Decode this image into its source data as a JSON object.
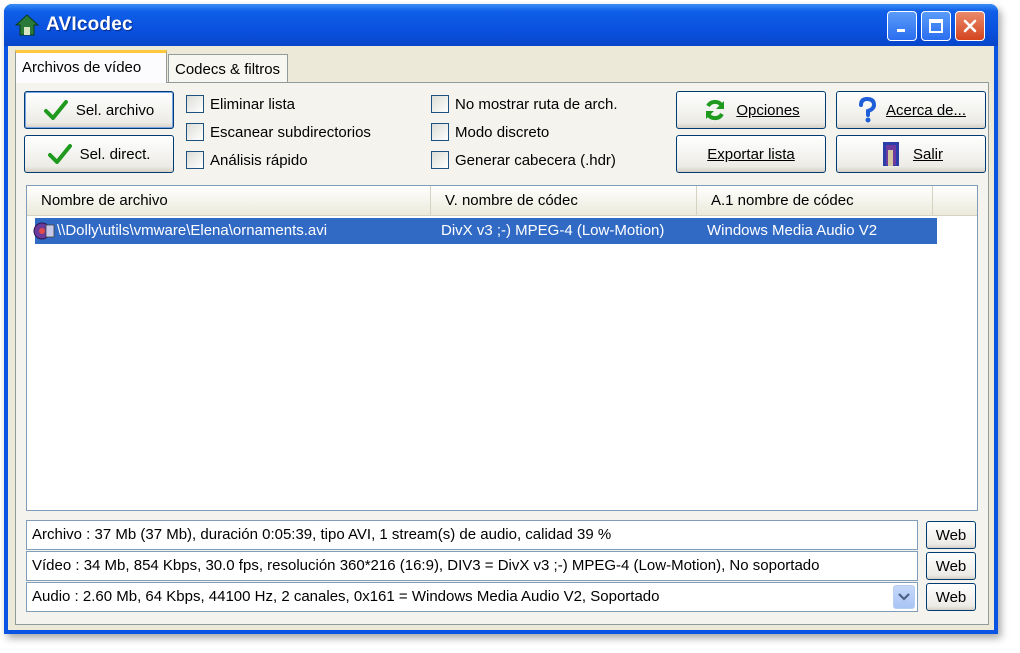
{
  "window": {
    "title": "AVIcodec"
  },
  "tabs": [
    {
      "label": "Archivos de vídeo",
      "active": true
    },
    {
      "label": "Codecs & filtros",
      "active": false
    }
  ],
  "buttons": {
    "sel_archivo": {
      "label": "Sel. archivo",
      "icon": "check-icon"
    },
    "sel_direct": {
      "label": "Sel. direct.",
      "icon": "check-icon"
    },
    "opciones": {
      "label": "Opciones",
      "icon": "refresh-icon"
    },
    "acerca": {
      "label": "Acerca de...",
      "icon": "help-icon"
    },
    "exportar": {
      "label": "Exportar lista"
    },
    "salir": {
      "label": "Salir",
      "icon": "exit-door-icon"
    }
  },
  "checkboxes": [
    {
      "label": "Eliminar lista",
      "checked": false
    },
    {
      "label": "Escanear subdirectorios",
      "checked": false
    },
    {
      "label": "Análisis rápido",
      "checked": false
    },
    {
      "label": "No mostrar ruta de arch.",
      "checked": false
    },
    {
      "label": "Modo discreto",
      "checked": false
    },
    {
      "label": "Generar cabecera (.hdr)",
      "checked": false
    }
  ],
  "list": {
    "columns": [
      "Nombre de archivo",
      "V. nombre de códec",
      "A.1 nombre de códec"
    ],
    "rows": [
      {
        "file": "\\\\Dolly\\utils\\vmware\\Elena\\ornaments.avi",
        "video_codec": "DivX v3 ;-) MPEG-4 (Low-Motion)",
        "audio_codec": "Windows Media Audio V2",
        "selected": true
      }
    ]
  },
  "info": {
    "archivo": "Archivo : 37 Mb (37 Mb), duración 0:05:39, tipo AVI, 1 stream(s) de audio, calidad 39 %",
    "video": "Vídeo : 34 Mb, 854 Kbps, 30.0 fps, resolución 360*216 (16:9),  DIV3 = DivX v3 ;-) MPEG-4 (Low-Motion), No soportado",
    "audio": "Audio : 2.60 Mb, 64 Kbps, 44100 Hz, 2 canales, 0x161 = Windows Media Audio V2, Soportado",
    "web_label": "Web"
  },
  "colors": {
    "titlebar": "#0a54e3",
    "selection": "#316ac5",
    "face": "#ece9d8",
    "check_green": "#1f9a1f"
  }
}
